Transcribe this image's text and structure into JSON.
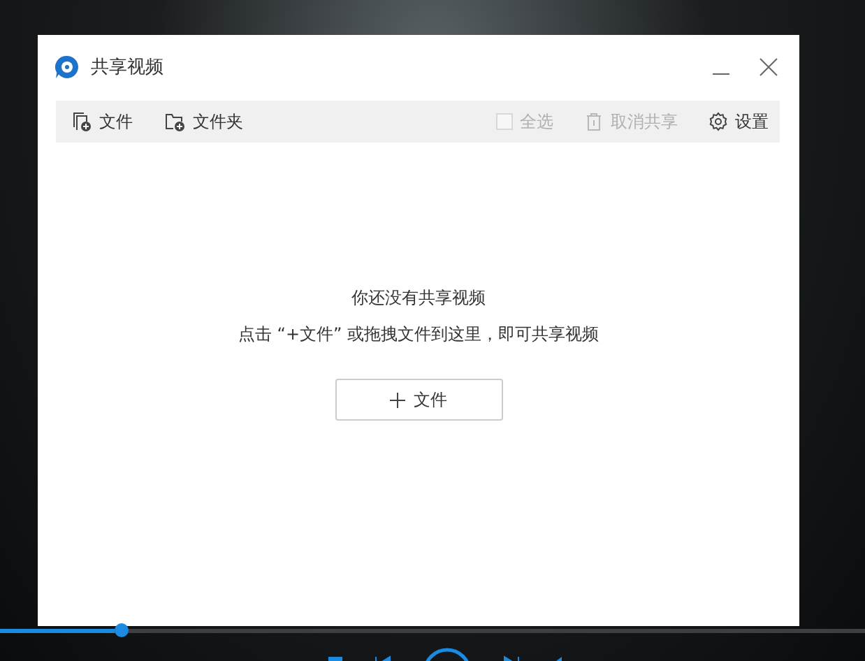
{
  "window": {
    "title": "共享视频"
  },
  "toolbar": {
    "left": [
      {
        "kind": "add-file",
        "label": "文件",
        "disabled": false
      },
      {
        "kind": "add-folder",
        "label": "文件夹",
        "disabled": false
      }
    ],
    "right": [
      {
        "kind": "checkbox",
        "label": "全选",
        "checked": false,
        "disabled": true
      },
      {
        "kind": "unshare",
        "label": "取消共享",
        "disabled": true
      },
      {
        "kind": "settings",
        "label": "设置",
        "disabled": false
      }
    ]
  },
  "empty_state": {
    "title": "你还没有共享视频",
    "hint": "点击 “+文件” 或拖拽文件到这里，即可共享视频",
    "button": {
      "label": "文件"
    }
  },
  "player": {
    "progress": {
      "level": 0.14
    }
  }
}
